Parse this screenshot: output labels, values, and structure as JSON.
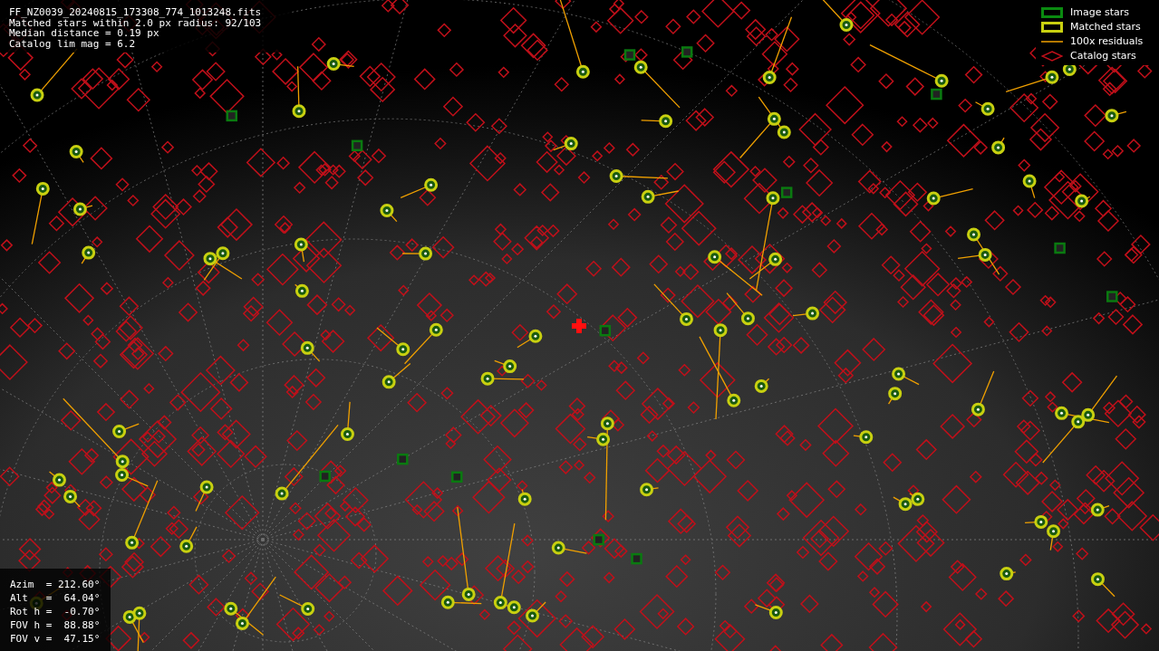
{
  "info_lines": [
    "FF_NZ0039_20240815_173308_774_1013248.fits",
    "Matched stars within 2.0 px radius: 92/103",
    "Median distance = 0.19 px",
    "Catalog lim mag = 6.2"
  ],
  "legend": [
    {
      "kind": "image",
      "label": "Image stars"
    },
    {
      "kind": "matched",
      "label": "Matched stars"
    },
    {
      "kind": "residual",
      "label": "100x residuals"
    },
    {
      "kind": "catalog",
      "label": "Catalog stars"
    }
  ],
  "pointing": [
    "Azim  = 212.60°",
    "Alt   =  64.04°",
    "Rot h =  -0.70°",
    "FOV h =  88.88°",
    "FOV v =  47.15°"
  ]
}
